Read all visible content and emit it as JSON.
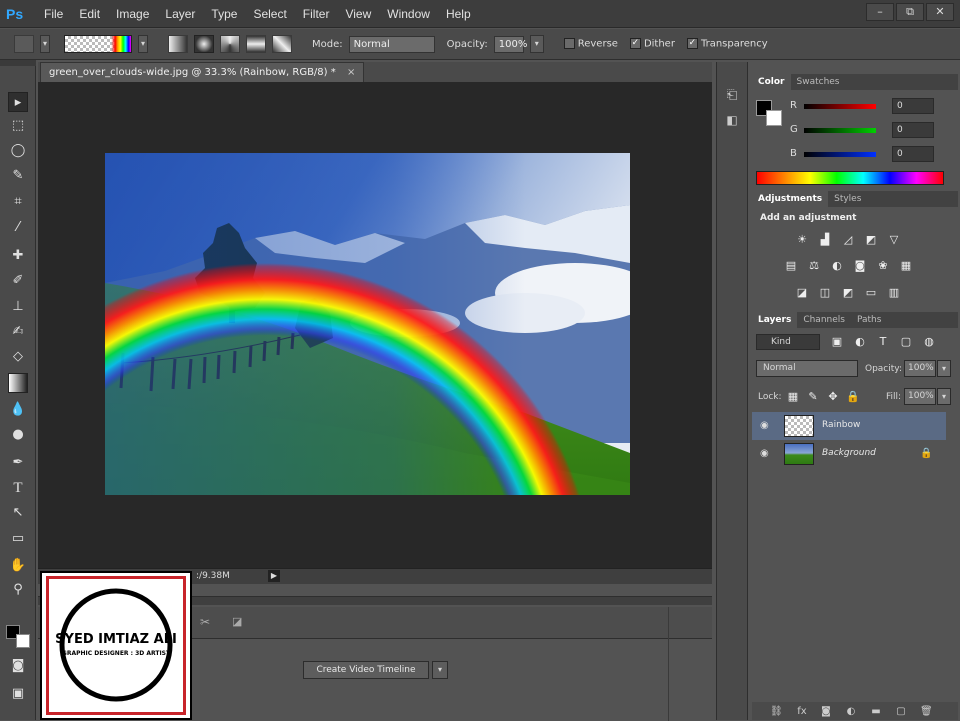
{
  "app": {
    "logo": "Ps"
  },
  "menu": [
    "File",
    "Edit",
    "Image",
    "Layer",
    "Type",
    "Select",
    "Filter",
    "View",
    "Window",
    "Help"
  ],
  "window_controls": [
    "–",
    "⧉",
    "✕"
  ],
  "options": {
    "mode_label": "Mode:",
    "mode_value": "Normal",
    "opacity_label": "Opacity:",
    "opacity_value": "100%",
    "reverse_label": "Reverse",
    "dither_label": "Dither",
    "transparency_label": "Transparency"
  },
  "document": {
    "tab_title": "green_over_clouds-wide.jpg @ 33.3% (Rainbow, RGB/8) *",
    "status_doc": ":/9.38M"
  },
  "timeline": {
    "create_button": "Create Video Timeline"
  },
  "color_panel": {
    "tabs": [
      "Color",
      "Swatches"
    ],
    "channels": [
      {
        "label": "R",
        "value": "0",
        "color": "#ff0000"
      },
      {
        "label": "G",
        "value": "0",
        "color": "#00c000"
      },
      {
        "label": "B",
        "value": "0",
        "color": "#0040ff"
      }
    ]
  },
  "adjustments_panel": {
    "tabs": [
      "Adjustments",
      "Styles"
    ],
    "heading": "Add an adjustment"
  },
  "layers_panel": {
    "tabs": [
      "Layers",
      "Channels",
      "Paths"
    ],
    "kind_label": "Kind",
    "blend_mode": "Normal",
    "opacity_label": "Opacity:",
    "opacity_value": "100%",
    "lock_label": "Lock:",
    "fill_label": "Fill:",
    "fill_value": "100%",
    "layers": [
      {
        "name": "Rainbow",
        "selected": true
      },
      {
        "name": "Background",
        "selected": false
      }
    ]
  },
  "watermark": {
    "name": "SYED IMTIAZ ALI",
    "subtitle": "GRAPHIC DESIGNER : 3D ARTIST"
  }
}
